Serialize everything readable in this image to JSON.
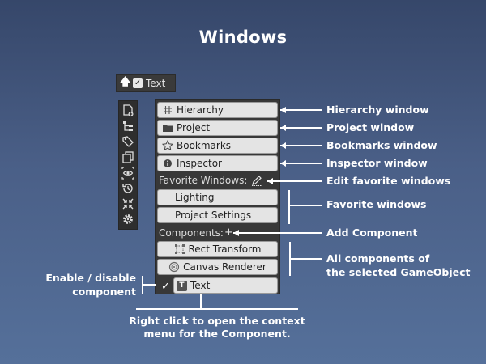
{
  "title": "Windows",
  "chip": {
    "label": "Text",
    "arrow_icon": "arrow-up-icon",
    "checkbox_checked": true
  },
  "toolbar": {
    "icons": [
      "add-document-icon",
      "hierarchy-tree-icon",
      "tag-icon",
      "copy-windows-icon",
      "visibility-icon",
      "history-icon",
      "collapse-icon",
      "gear-icon"
    ]
  },
  "panel": {
    "windows": [
      {
        "label": "Hierarchy",
        "icon": "hash-icon"
      },
      {
        "label": "Project",
        "icon": "folder-icon"
      },
      {
        "label": "Bookmarks",
        "icon": "star-icon"
      },
      {
        "label": "Inspector",
        "icon": "info-icon"
      }
    ],
    "favorite_label": "Favorite Windows:",
    "favorites": [
      {
        "label": "Lighting"
      },
      {
        "label": "Project Settings"
      }
    ],
    "components_label": "Components:",
    "add_symbol": "+",
    "components": [
      {
        "label": "Rect Transform",
        "icon": "rect-transform-icon"
      },
      {
        "label": "Canvas Renderer",
        "icon": "canvas-renderer-icon"
      }
    ],
    "text_component": {
      "label": "Text",
      "badge": "T",
      "check": "✓"
    }
  },
  "callouts": {
    "hierarchy": "Hierarchy window",
    "project": "Project window",
    "bookmarks": "Bookmarks window",
    "inspector": "Inspector window",
    "edit_favorites": "Edit favorite windows",
    "favorites": "Favorite windows",
    "add_component": "Add Component",
    "all_components_1": "All components of",
    "all_components_2": "the selected GameObject",
    "enable_1": "Enable / disable",
    "enable_2": "component",
    "right_click_1": "Right click to open the context",
    "right_click_2": "menu for the Component."
  }
}
